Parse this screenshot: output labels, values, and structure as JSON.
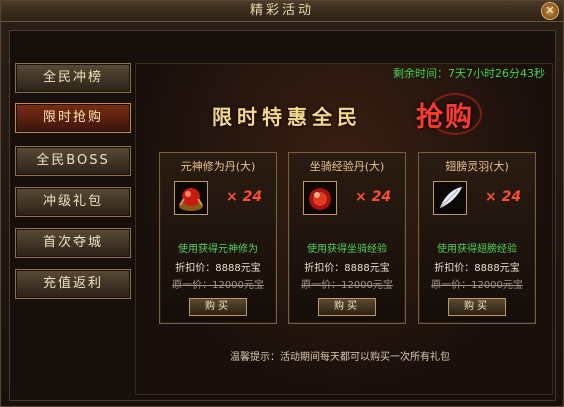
{
  "window": {
    "title": "精彩活动",
    "close_label": "✕"
  },
  "sidebar": {
    "items": [
      {
        "label": "全民冲榜"
      },
      {
        "label": "限时抢购"
      },
      {
        "label": "全民BOSS"
      },
      {
        "label": "冲级礼包"
      },
      {
        "label": "首次夺城"
      },
      {
        "label": "充值返利"
      }
    ],
    "active_index": 1
  },
  "main": {
    "countdown": "剩余时间：7天7小时26分43秒",
    "banner_left": "限时特惠全民",
    "banner_right": "抢购",
    "cards": [
      {
        "title": "元神修为丹(大)",
        "multiplier": "× 24",
        "desc": "使用获得元神修为",
        "discount": "折扣价：8888元宝",
        "original": "原一价：12000元宝",
        "buy_label": "购买",
        "icon": "red-orb-icon"
      },
      {
        "title": "坐骑经验丹(大)",
        "multiplier": "× 24",
        "desc": "使用获得坐骑经验",
        "discount": "折扣价：8888元宝",
        "original": "原一价：12000元宝",
        "buy_label": "购买",
        "icon": "red-pill-icon"
      },
      {
        "title": "翅膀灵羽(大)",
        "multiplier": "× 24",
        "desc": "使用获得翅膀经验",
        "discount": "折扣价：8888元宝",
        "original": "原一价：12000元宝",
        "buy_label": "购买",
        "icon": "feather-icon"
      }
    ],
    "tip": "温馨提示：活动期间每天都可以购买一次所有礼包"
  }
}
